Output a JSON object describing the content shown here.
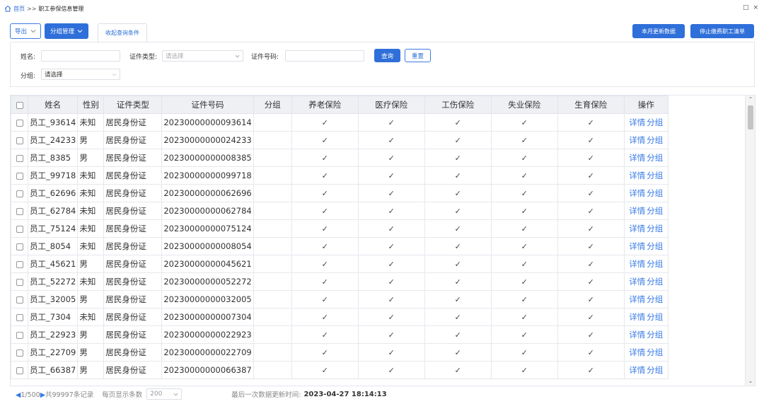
{
  "breadcrumb": {
    "home": "首页",
    "separator": ">>",
    "current": "职工参保信息管理"
  },
  "window_controls": {
    "maximize": "□",
    "close": "×"
  },
  "toolbar": {
    "export_label": "导出",
    "group_manage_label": "分组管理",
    "collapse_query_label": "收起查询条件",
    "monthly_update_label": "本月更新数据",
    "stop_payment_label": "停止缴费职工清单"
  },
  "filter": {
    "name_label": "姓名:",
    "name_value": "",
    "id_type_label": "证件类型:",
    "id_type_placeholder": "请选择",
    "id_number_label": "证件号码:",
    "id_number_value": "",
    "query_label": "查询",
    "reset_label": "重置",
    "group_label": "分组:",
    "group_value": "请选择"
  },
  "table": {
    "headers": [
      "姓名",
      "性别",
      "证件类型",
      "证件号码",
      "分组",
      "养老保险",
      "医疗保险",
      "工伤保险",
      "失业保险",
      "生育保险",
      "操作"
    ],
    "check_mark": "✓",
    "op_detail": "详情",
    "op_group": "分组",
    "rows": [
      {
        "name": "员工_93614",
        "gender": "未知",
        "id_type": "居民身份证",
        "id_number": "20230000000093614"
      },
      {
        "name": "员工_24233",
        "gender": "男",
        "id_type": "居民身份证",
        "id_number": "20230000000024233"
      },
      {
        "name": "员工_8385",
        "gender": "男",
        "id_type": "居民身份证",
        "id_number": "20230000000008385"
      },
      {
        "name": "员工_99718",
        "gender": "未知",
        "id_type": "居民身份证",
        "id_number": "20230000000099718"
      },
      {
        "name": "员工_62696",
        "gender": "未知",
        "id_type": "居民身份证",
        "id_number": "20230000000062696"
      },
      {
        "name": "员工_62784",
        "gender": "未知",
        "id_type": "居民身份证",
        "id_number": "20230000000062784"
      },
      {
        "name": "员工_75124",
        "gender": "未知",
        "id_type": "居民身份证",
        "id_number": "20230000000075124"
      },
      {
        "name": "员工_8054",
        "gender": "未知",
        "id_type": "居民身份证",
        "id_number": "20230000000008054"
      },
      {
        "name": "员工_45621",
        "gender": "男",
        "id_type": "居民身份证",
        "id_number": "20230000000045621"
      },
      {
        "name": "员工_52272",
        "gender": "未知",
        "id_type": "居民身份证",
        "id_number": "20230000000052272"
      },
      {
        "name": "员工_32005",
        "gender": "男",
        "id_type": "居民身份证",
        "id_number": "20230000000032005"
      },
      {
        "name": "员工_7304",
        "gender": "未知",
        "id_type": "居民身份证",
        "id_number": "20230000000007304"
      },
      {
        "name": "员工_22923",
        "gender": "男",
        "id_type": "居民身份证",
        "id_number": "20230000000022923"
      },
      {
        "name": "员工_22709",
        "gender": "男",
        "id_type": "居民身份证",
        "id_number": "20230000000022709"
      },
      {
        "name": "员工_66387",
        "gender": "男",
        "id_type": "居民身份证",
        "id_number": "20230000000066387"
      }
    ]
  },
  "footer": {
    "page_info": "1/500",
    "total_records": "共99997条记录",
    "page_size_label": "每页显示条数",
    "page_size_value": "200",
    "last_update_label": "最后一次数据更新时间:",
    "last_update_time": "2023-04-27 18:14:13"
  },
  "colors": {
    "accent": "#2f6fd9",
    "link": "#3478e6",
    "header_bg": "#eef0f4"
  }
}
